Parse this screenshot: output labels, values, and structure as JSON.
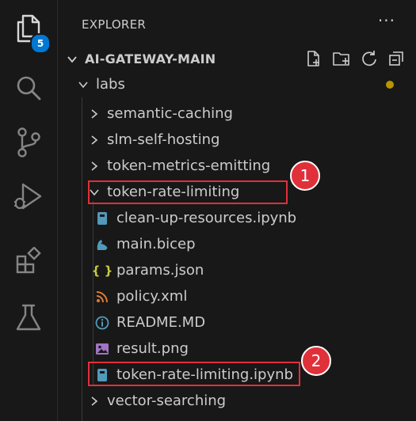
{
  "colors": {
    "background": "#181818",
    "text": "#cccccc",
    "icon": "#858585",
    "active_icon": "#d7d7d7",
    "badge": "#0078d4",
    "highlight": "#e0303a",
    "modified_dot": "#b89500"
  },
  "activity_bar": {
    "explorer_badge": "5",
    "items": [
      {
        "name": "explorer",
        "icon": "files-icon"
      },
      {
        "name": "search",
        "icon": "search-icon"
      },
      {
        "name": "source-control",
        "icon": "source-control-icon"
      },
      {
        "name": "run-and-debug",
        "icon": "run-debug-icon"
      },
      {
        "name": "extensions",
        "icon": "extensions-icon"
      },
      {
        "name": "testing",
        "icon": "beaker-icon"
      }
    ]
  },
  "explorer": {
    "header": "EXPLORER",
    "more_actions": "···",
    "workspace": {
      "title": "AI-GATEWAY-MAIN",
      "actions": [
        "new-file-icon",
        "new-folder-icon",
        "refresh-icon",
        "collapse-all-icon"
      ]
    },
    "tree": [
      {
        "label": "labs",
        "type": "folder",
        "expanded": true
      },
      {
        "label": "semantic-caching",
        "type": "folder",
        "expanded": false
      },
      {
        "label": "slm-self-hosting",
        "type": "folder",
        "expanded": false
      },
      {
        "label": "token-metrics-emitting",
        "type": "folder",
        "expanded": false
      },
      {
        "label": "token-rate-limiting",
        "type": "folder",
        "expanded": true
      },
      {
        "label": "clean-up-resources.ipynb",
        "type": "file",
        "icon": "notebook-icon",
        "glyph": "",
        "color": "#519aba"
      },
      {
        "label": "main.bicep",
        "type": "file",
        "icon": "bicep-icon",
        "glyph": "",
        "color": "#519aba"
      },
      {
        "label": "params.json",
        "type": "file",
        "icon": "json-icon",
        "glyph": "{ }",
        "color": "#cbcb41"
      },
      {
        "label": "policy.xml",
        "type": "file",
        "icon": "rss-icon",
        "glyph": "",
        "color": "#e37933"
      },
      {
        "label": "README.MD",
        "type": "file",
        "icon": "info-icon",
        "glyph": "",
        "color": "#519aba"
      },
      {
        "label": "result.png",
        "type": "file",
        "icon": "image-icon",
        "glyph": "",
        "color": "#a074c4"
      },
      {
        "label": "token-rate-limiting.ipynb",
        "type": "file",
        "icon": "notebook-icon",
        "glyph": "",
        "color": "#519aba"
      },
      {
        "label": "vector-searching",
        "type": "folder",
        "expanded": false
      }
    ]
  },
  "callouts": [
    "1",
    "2"
  ]
}
